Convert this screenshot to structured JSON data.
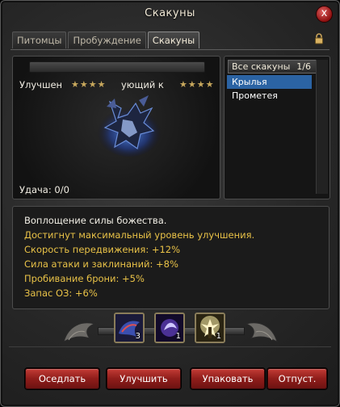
{
  "window": {
    "title": "Скакуны",
    "close_label": "x"
  },
  "tabs": [
    {
      "label": "Питомцы"
    },
    {
      "label": "Пробуждение"
    },
    {
      "label": "Скакуны",
      "active": true
    }
  ],
  "mount_view": {
    "improved_label": "Улучшен",
    "next_label": "ующий к",
    "luck_label": "Удача: 0/0",
    "stars_left": "★★★★",
    "stars_right": "★★★★"
  },
  "mount_list": {
    "header": "Все скакуны",
    "count": "1/6",
    "items": [
      {
        "label": "Крылья Прометея",
        "selected": true
      }
    ]
  },
  "description": {
    "lines": [
      {
        "text": "Воплощение силы божества.",
        "color": "white"
      },
      {
        "text": "Достигнут максимальный уровень улучшения.",
        "color": "yellow"
      },
      {
        "text": "Скорость передвижения: +12%",
        "color": "yellow"
      },
      {
        "text": "Сила атаки и заклинаний: +8%",
        "color": "yellow"
      },
      {
        "text": "Пробивание брони: +5%",
        "color": "yellow"
      },
      {
        "text": "Запас ОЗ: +6%",
        "color": "yellow"
      }
    ]
  },
  "item_slots": [
    {
      "icon": "mount-item-icon",
      "count": "3"
    },
    {
      "icon": "spirit-item-icon",
      "count": "1"
    },
    {
      "icon": "angel-item-icon",
      "count": "1"
    }
  ],
  "buttons": {
    "ride": "Оседлать",
    "upgrade": "Улучшить",
    "pack": "Упаковать",
    "release": "Отпуст."
  },
  "colors": {
    "accent_yellow": "#e9c247",
    "selected_blue": "#2b63a3",
    "button_red": "#a02a25"
  }
}
